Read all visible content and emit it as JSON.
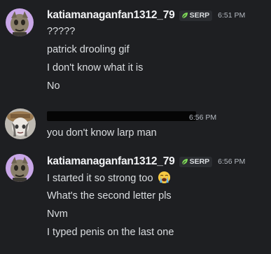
{
  "groups": [
    {
      "username": "katiamanaganfan1312_79",
      "tag": "SERP",
      "timestamp": "6:51 PM",
      "messages": [
        "?????",
        "patrick drooling gif",
        "I don't know what it is",
        "No"
      ]
    },
    {
      "username": "",
      "timestamp": "6:56 PM",
      "messages": [
        "you don't know larp man"
      ]
    },
    {
      "username": "katiamanaganfan1312_79",
      "tag": "SERP",
      "timestamp": "6:56 PM",
      "messages": [
        "I started it so strong too",
        "What's the second letter pls",
        "Nvm",
        "I typed penis on the last one"
      ]
    }
  ],
  "icons": {
    "tag": "leaf-icon",
    "emoji": "loudly-crying-face-emoji"
  },
  "colors": {
    "background": "#1e1f22",
    "username": "#f2f3f5",
    "text": "#dbdee1",
    "timestamp": "#b5bac1",
    "tag_leaf": "#7ed957"
  }
}
